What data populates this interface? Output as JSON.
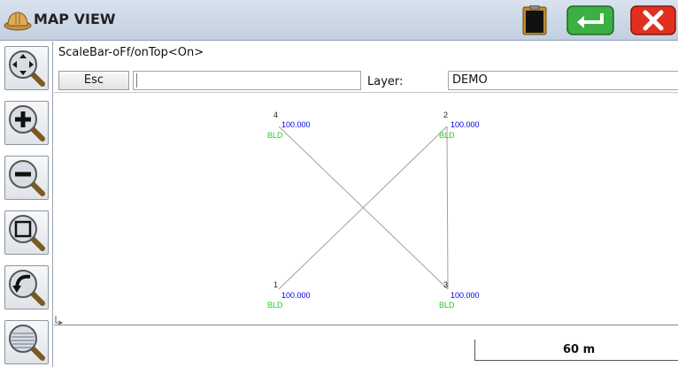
{
  "title": "MAP VIEW",
  "command_text": "ScaleBar-oFf/onTop<On>",
  "esc_label": "Esc",
  "command_input": "",
  "layer_label": "Layer:",
  "layer_value": "DEMO",
  "scale_text": "60 m",
  "points": [
    {
      "id": "4",
      "elevation": "100.000",
      "code": "BLD"
    },
    {
      "id": "2",
      "elevation": "100.000",
      "code": "BLD"
    },
    {
      "id": "1",
      "elevation": "100.000",
      "code": "BLD"
    },
    {
      "id": "3",
      "elevation": "100.000",
      "code": "BLD"
    }
  ],
  "colors": {
    "elevation_text": "#0000ee",
    "code_text": "#22cc22",
    "lines": "#a0a0a0",
    "close_button": "#e03020",
    "enter_button": "#3cb043"
  }
}
